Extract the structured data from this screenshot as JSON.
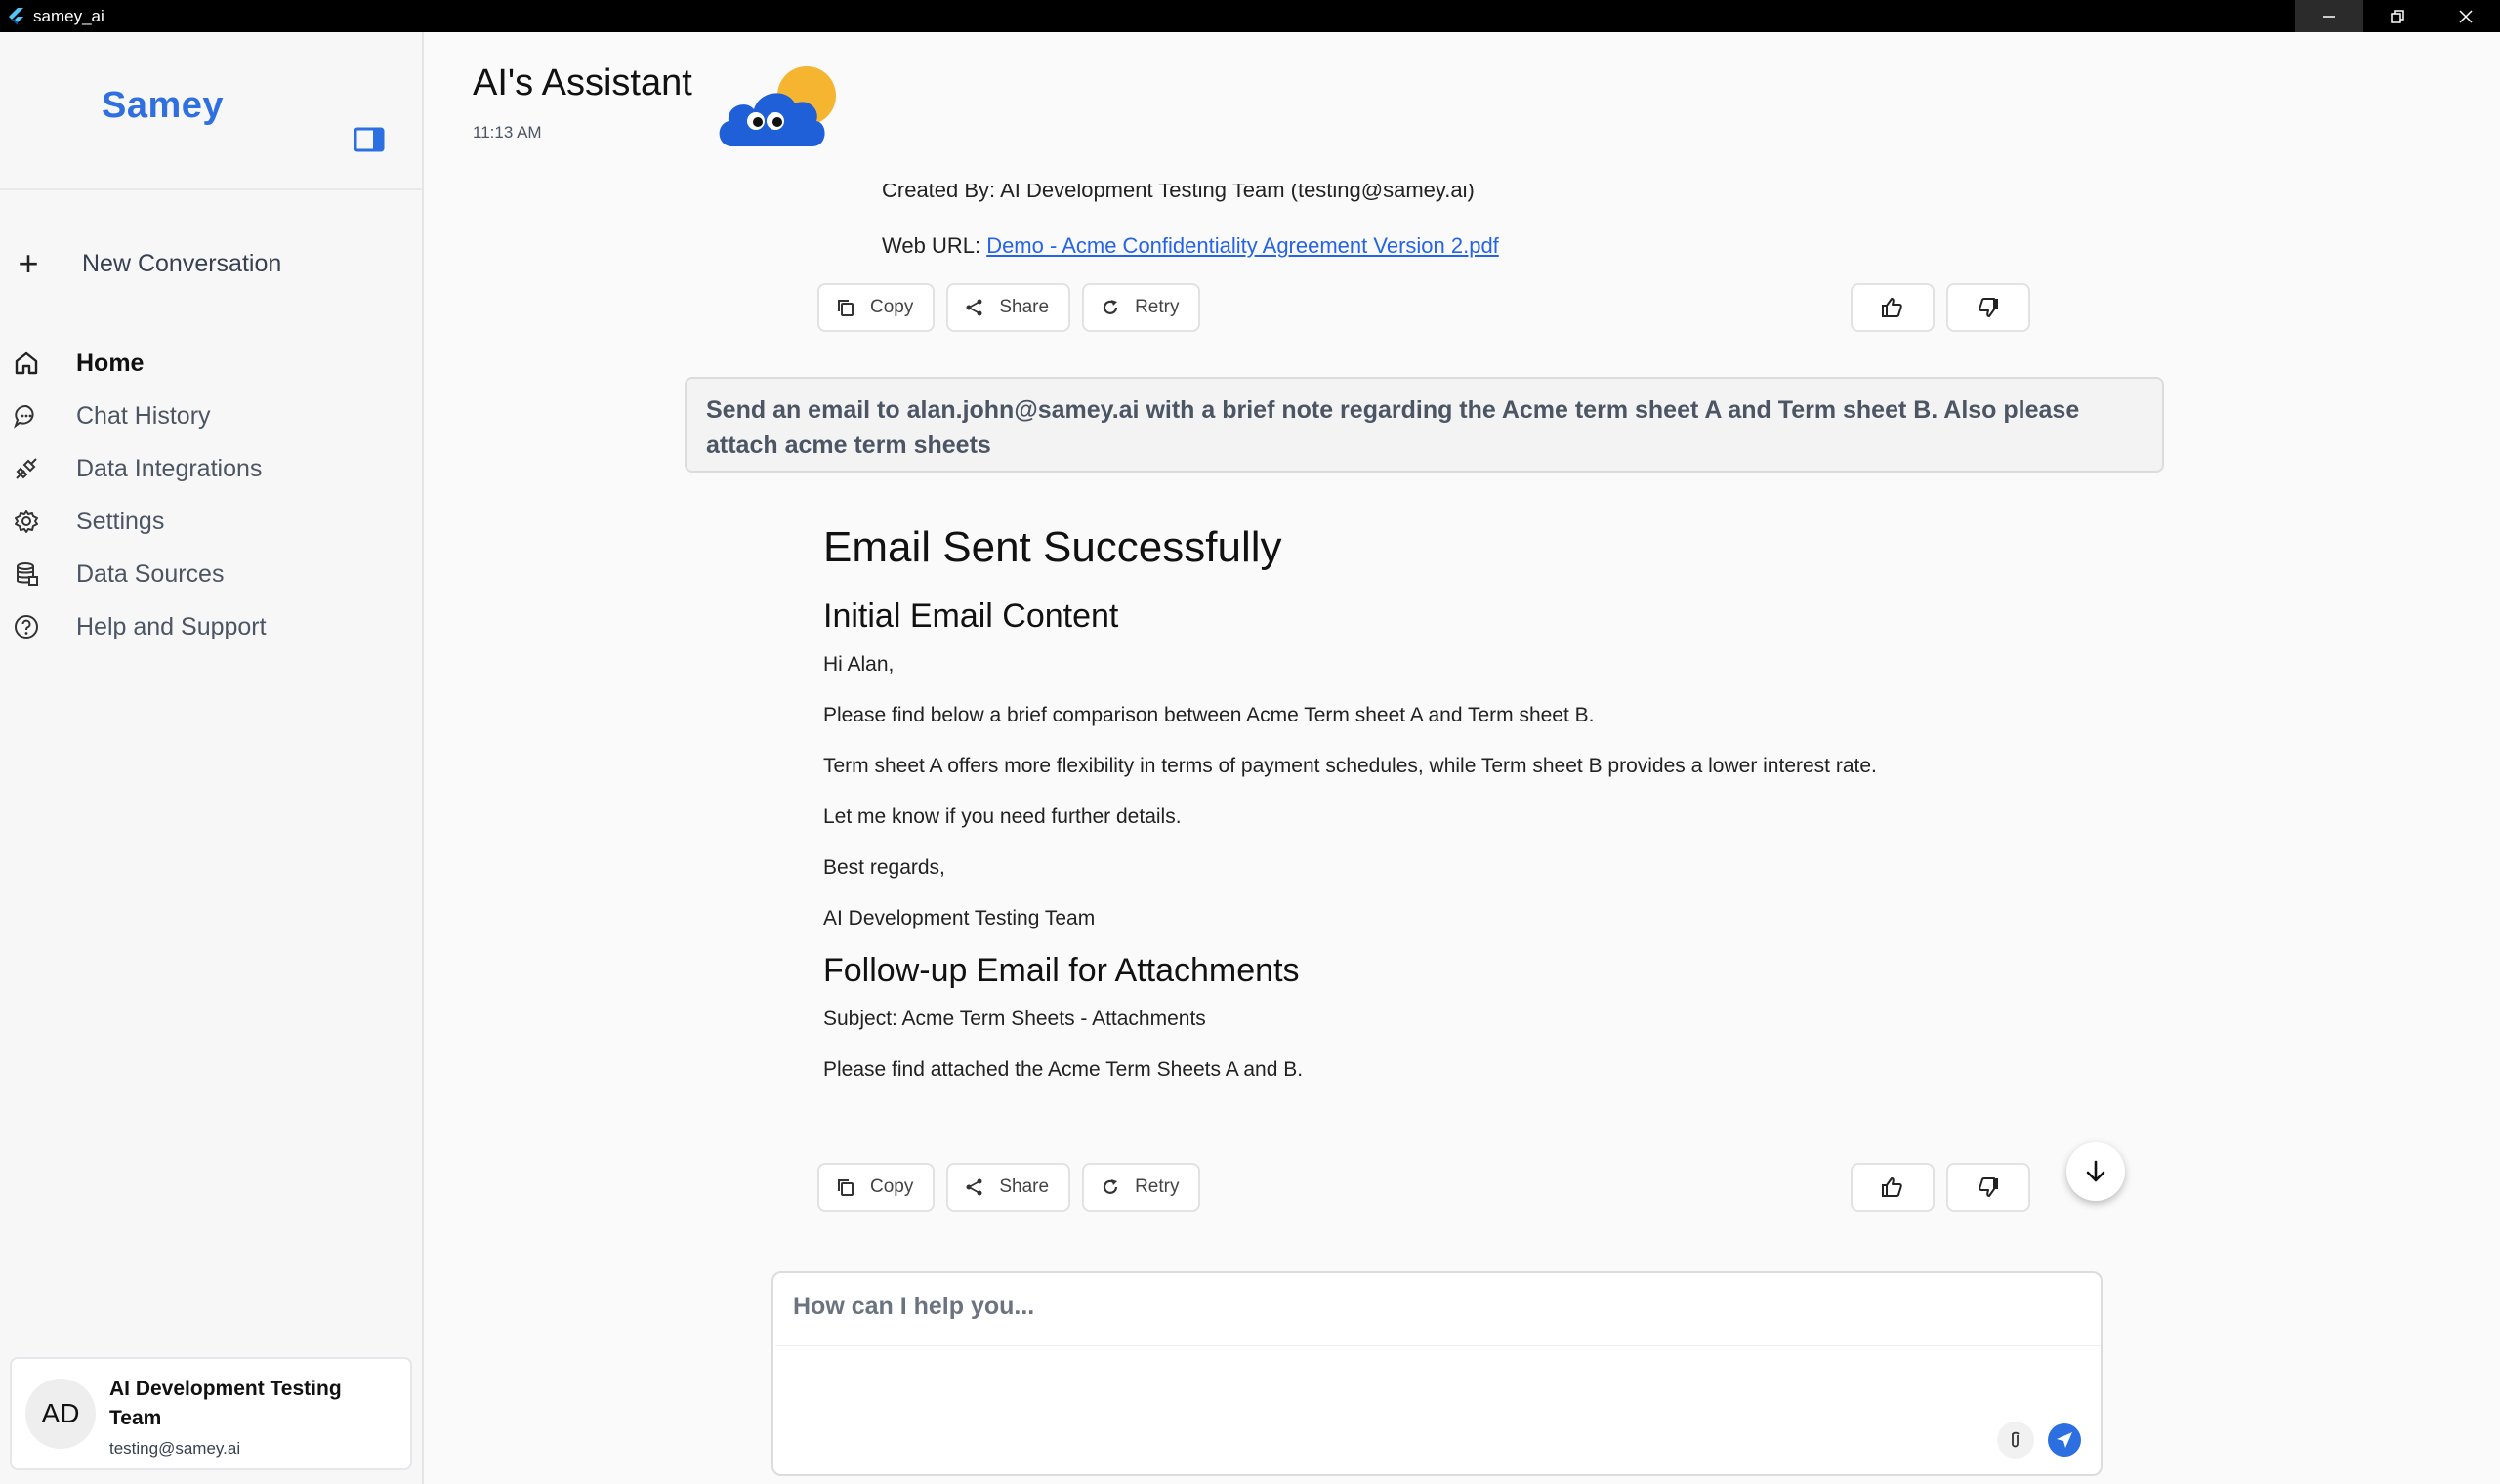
{
  "window": {
    "title": "samey_ai"
  },
  "sidebar": {
    "brand": "Samey",
    "new_conversation": "New Conversation",
    "nav": [
      {
        "label": "Home",
        "icon": "home-icon"
      },
      {
        "label": "Chat History",
        "icon": "chat-bubble-icon"
      },
      {
        "label": "Data Integrations",
        "icon": "plug-icon"
      },
      {
        "label": "Settings",
        "icon": "gear-icon"
      },
      {
        "label": "Data Sources",
        "icon": "database-icon"
      },
      {
        "label": "Help and Support",
        "icon": "help-circle-icon"
      }
    ],
    "user": {
      "initials": "AD",
      "name": "AI Development Testing Team",
      "email": "testing@samey.ai"
    }
  },
  "header": {
    "title": "AI's Assistant",
    "time": "11:13 AM"
  },
  "prev_response": {
    "created_by": "Created By: AI Development Testing Team (testing@samey.ai)",
    "web_url_label": "Web URL: ",
    "web_url_link": "Demo - Acme Confidentiality Agreement Version 2.pdf"
  },
  "actions": {
    "copy": "Copy",
    "share": "Share",
    "retry": "Retry"
  },
  "user_message": "Send an email to alan.john@samey.ai with a brief note regarding the Acme term sheet A and Term sheet B. Also please attach acme term sheets",
  "response": {
    "title": "Email Sent Successfully",
    "section1_title": "Initial Email Content",
    "greeting": "Hi Alan,",
    "p1": "Please find below a brief comparison between Acme Term sheet A and Term sheet B.",
    "p2": "Term sheet A offers more flexibility in terms of payment schedules, while Term sheet B provides a lower interest rate.",
    "p3": "Let me know if you need further details.",
    "signoff": "Best regards,",
    "signature": "AI Development Testing Team",
    "section2_title": "Follow-up Email for Attachments",
    "subject": "Subject: Acme Term Sheets - Attachments",
    "p4": "Please find attached the Acme Term Sheets A and B."
  },
  "input": {
    "placeholder": "How can I help you..."
  },
  "colors": {
    "accent": "#2b6fe0",
    "link": "#2563eb"
  }
}
